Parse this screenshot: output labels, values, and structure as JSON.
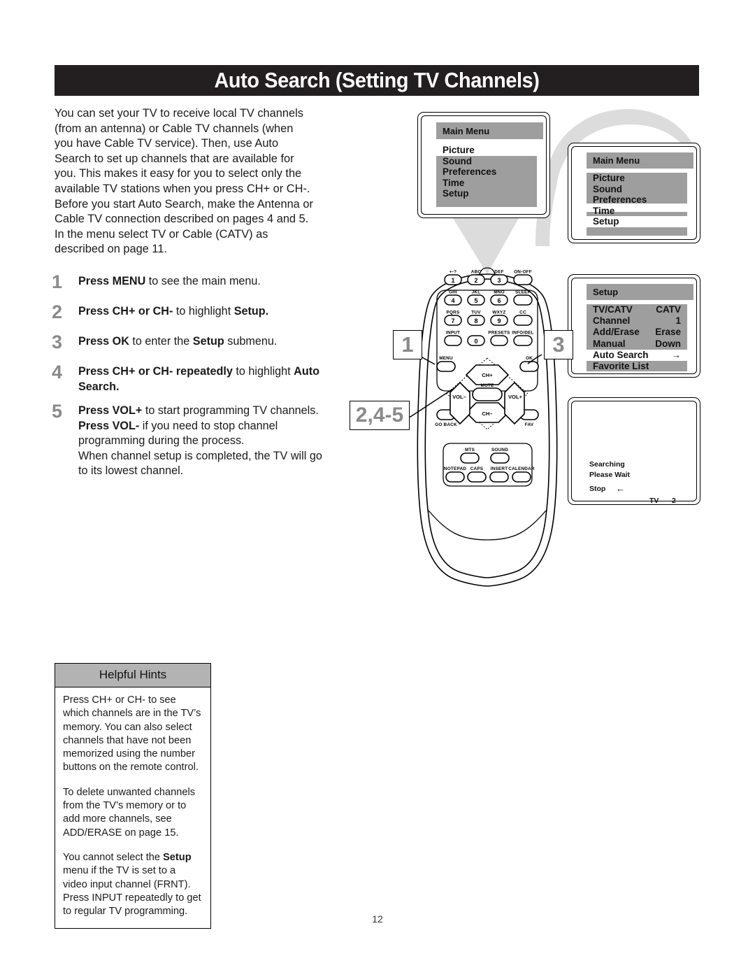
{
  "page": {
    "title": "Auto Search (Setting TV Channels)",
    "number": "12"
  },
  "intro": "You can set your TV to receive local TV channels (from an antenna) or Cable TV channels (when you have Cable TV service). Then, use Auto Search to set up channels that are available for you. This makes it easy for you to select only the available TV stations when you press CH+ or CH-. Before you start Auto Search, make the Antenna or Cable TV connection described on pages 4 and 5. In the menu select TV or Cable (CATV) as described on page 11.",
  "steps": [
    {
      "num": "1",
      "html": "<b>Press MENU</b> to see the main menu."
    },
    {
      "num": "2",
      "html": "<b>Press CH+ or CH-</b> to highlight <b>Setup.</b>"
    },
    {
      "num": "3",
      "html": "<b>Press OK</b> to enter the <b>Setup</b> submenu."
    },
    {
      "num": "4",
      "html": "<b>Press CH+ or CH- repeatedly</b> to highlight <b>Auto Search.</b>"
    },
    {
      "num": "5",
      "html": "<b>Press VOL+</b> to start programming TV channels. <b>Press VOL-</b> if you need to stop channel programming during the process.<br>When channel setup is completed, the TV will go to its lowest channel."
    }
  ],
  "hints": {
    "header": "Helpful Hints",
    "paragraphs": [
      "Press CH+ or CH- to see which channels are in the TV’s memory. You can also select channels that have not been memorized using the number buttons on the remote control.",
      "To delete unwanted channels from the TV’s memory or to add more channels, see ADD/ERASE on page 15.",
      "You cannot select the <b>Setup</b> menu if the TV is set to a video input channel (FRNT). Press INPUT repeatedly to get to regular TV programming."
    ]
  },
  "osd": {
    "main_menu_1": {
      "title": "Main Menu",
      "items": [
        {
          "label": "Picture",
          "selected": true
        },
        {
          "label": "Sound",
          "selected": false
        },
        {
          "label": "Preferences",
          "selected": false
        },
        {
          "label": "Time",
          "selected": false
        },
        {
          "label": "Setup",
          "selected": false
        }
      ]
    },
    "main_menu_2": {
      "title": "Main Menu",
      "items": [
        {
          "label": "Picture",
          "selected": false
        },
        {
          "label": "Sound",
          "selected": false
        },
        {
          "label": "Preferences",
          "selected": false
        },
        {
          "label": "Time",
          "selected": false
        },
        {
          "label": "Setup",
          "selected": true
        }
      ]
    },
    "setup_menu": {
      "title": "Setup",
      "items": [
        {
          "label": "TV/CATV",
          "value": "CATV",
          "selected": false
        },
        {
          "label": "Channel",
          "value": "1",
          "selected": false
        },
        {
          "label": "Add/Erase",
          "value": "Erase",
          "selected": false
        },
        {
          "label": "Manual",
          "value": "Down",
          "selected": false
        },
        {
          "label": "Auto Search",
          "value": "→",
          "selected": true
        },
        {
          "label": "Favorite List",
          "value": "",
          "selected": false
        }
      ]
    },
    "searching_screen": {
      "line1": "Searching",
      "line2": "Please Wait",
      "line3": "Stop",
      "arrow": "←",
      "source": "TV",
      "channel": "2"
    }
  },
  "callouts": {
    "menu_badge": "1",
    "ok_badge": "3",
    "vol_badge": "2,4-5"
  },
  "remote": {
    "keypad": [
      {
        "key": "1",
        "letters": "+-?"
      },
      {
        "key": "2",
        "letters": "ABC"
      },
      {
        "key": "3",
        "letters": "DEF"
      },
      {
        "key": "",
        "letters": "ON-OFF"
      },
      {
        "key": "4",
        "letters": "GHI"
      },
      {
        "key": "5",
        "letters": "JKL"
      },
      {
        "key": "6",
        "letters": "MNO"
      },
      {
        "key": "",
        "letters": "SLEEP"
      },
      {
        "key": "7",
        "letters": "PQRS"
      },
      {
        "key": "8",
        "letters": "TUV"
      },
      {
        "key": "9",
        "letters": "WXYZ"
      },
      {
        "key": "",
        "letters": "CC"
      },
      {
        "key": "",
        "letters": "INPUT"
      },
      {
        "key": "0",
        "letters": ""
      },
      {
        "key": "",
        "letters": "PRESETS"
      },
      {
        "key": "",
        "letters": "INFO/DEL"
      }
    ],
    "nav": {
      "up": "CH+",
      "down": "CH–",
      "left": "VOL–",
      "right": "VOL+",
      "center": "MUTE"
    },
    "side_buttons": [
      {
        "label": "MENU"
      },
      {
        "label": "OK"
      },
      {
        "label": "GO BACK"
      },
      {
        "label": "FAV"
      }
    ],
    "bottom_buttons": [
      {
        "label": "MTS"
      },
      {
        "label": "SOUND"
      },
      {
        "label": "NOTEPAD"
      },
      {
        "label": "CAPS"
      },
      {
        "label": "INSERT"
      },
      {
        "label": "CALENDAR"
      }
    ]
  }
}
